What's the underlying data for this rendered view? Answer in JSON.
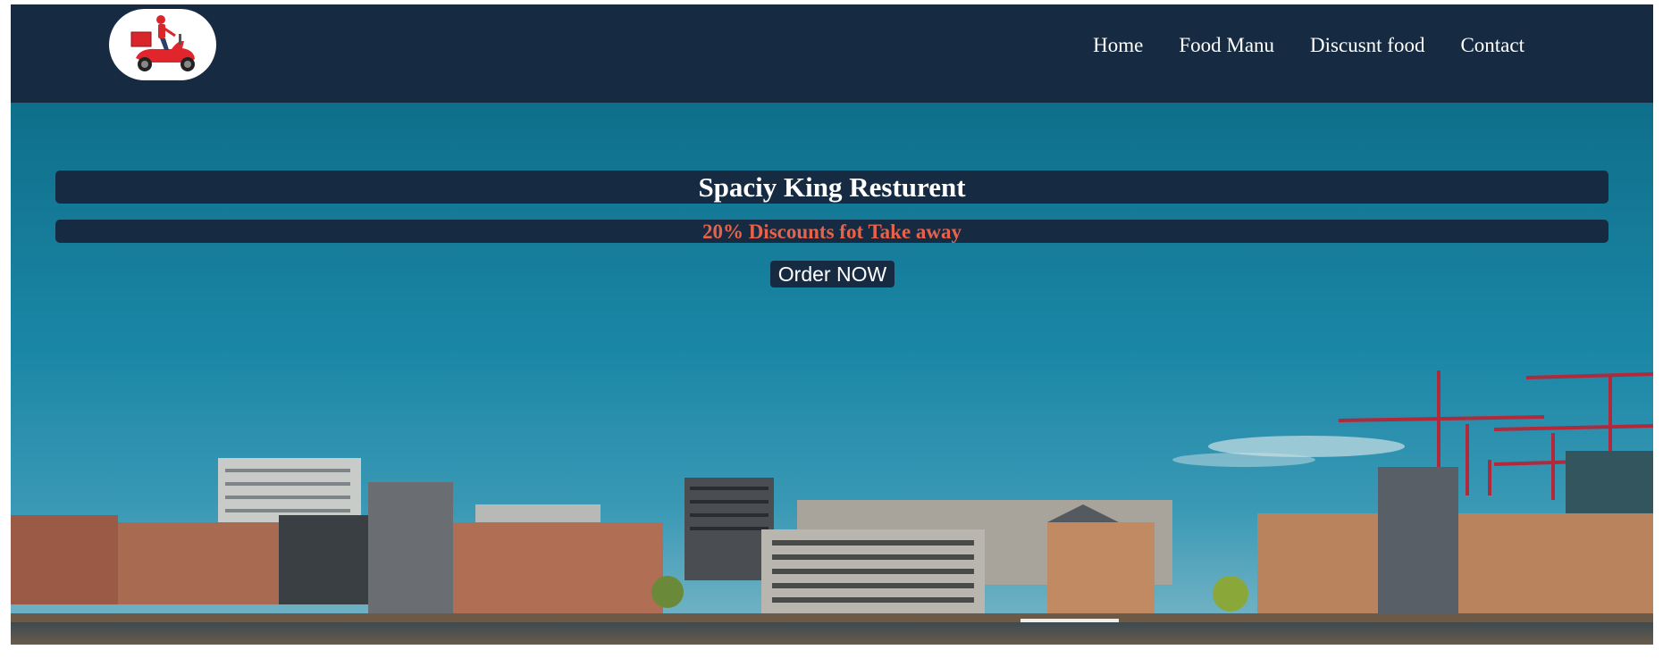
{
  "header": {
    "logo_icon": "delivery-scooter-icon",
    "nav": [
      {
        "label": "Home"
      },
      {
        "label": "Food Manu"
      },
      {
        "label": "Discusnt food"
      },
      {
        "label": "Contact"
      }
    ]
  },
  "hero": {
    "title": "Spaciy King Resturent",
    "discount": "20% Discounts fot Take away",
    "cta_label": "Order NOW",
    "background": "city-waterfront-skyline-image"
  },
  "colors": {
    "navbar": "#162b42",
    "discount_text": "#e8624a",
    "sky": "#107a9a"
  }
}
